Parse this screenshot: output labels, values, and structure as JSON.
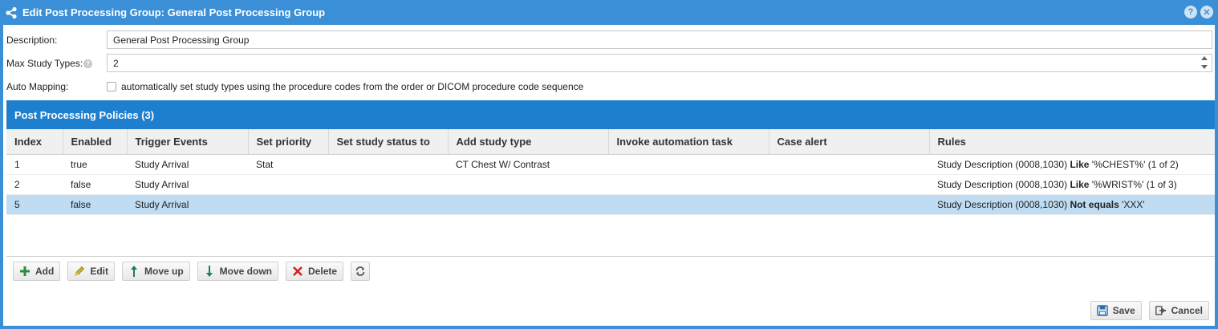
{
  "window": {
    "title": "Edit Post Processing Group: General Post Processing Group",
    "help_label": "?",
    "close_label": "✕"
  },
  "form": {
    "description_label": "Description:",
    "description_value": "General Post Processing Group",
    "max_study_types_label": "Max Study Types:",
    "max_study_types_value": "2",
    "auto_mapping_label": "Auto Mapping:",
    "auto_mapping_text": "automatically set study types using the procedure codes from the order or DICOM procedure code sequence",
    "auto_mapping_checked": false
  },
  "policies": {
    "header": "Post Processing Policies (3)",
    "columns": [
      "Index",
      "Enabled",
      "Trigger Events",
      "Set priority",
      "Set study status to",
      "Add study type",
      "Invoke automation task",
      "Case alert",
      "Rules"
    ],
    "rows": [
      {
        "index": "1",
        "enabled": "true",
        "trigger": "Study Arrival",
        "priority": "Stat",
        "status": "",
        "study_type": "CT Chest W/ Contrast",
        "task": "",
        "alert": "",
        "rule_pre": "Study Description (0008,1030) ",
        "rule_op": "Like",
        "rule_post": " '%CHEST%' (1 of 2)"
      },
      {
        "index": "2",
        "enabled": "false",
        "trigger": "Study Arrival",
        "priority": "",
        "status": "",
        "study_type": "",
        "task": "",
        "alert": "",
        "rule_pre": "Study Description (0008,1030) ",
        "rule_op": "Like",
        "rule_post": " '%WRIST%' (1 of 3)"
      },
      {
        "index": "5",
        "enabled": "false",
        "trigger": "Study Arrival",
        "priority": "",
        "status": "",
        "study_type": "",
        "task": "",
        "alert": "",
        "rule_pre": "Study Description (0008,1030) ",
        "rule_op": "Not equals",
        "rule_post": " 'XXX'"
      }
    ],
    "selected_row": 2
  },
  "toolbar": {
    "add_label": "Add",
    "edit_label": "Edit",
    "move_up_label": "Move up",
    "move_down_label": "Move down",
    "delete_label": "Delete",
    "refresh_icon": "refresh-icon"
  },
  "footer": {
    "save_label": "Save",
    "cancel_label": "Cancel"
  },
  "colors": {
    "titlebar": "#3a8fd6",
    "panel_header": "#1f7fcf",
    "selected_row": "#bfdcf2",
    "add_icon": "#2e8b3e",
    "delete_icon": "#d42020",
    "move_icon": "#1e7a6a"
  }
}
